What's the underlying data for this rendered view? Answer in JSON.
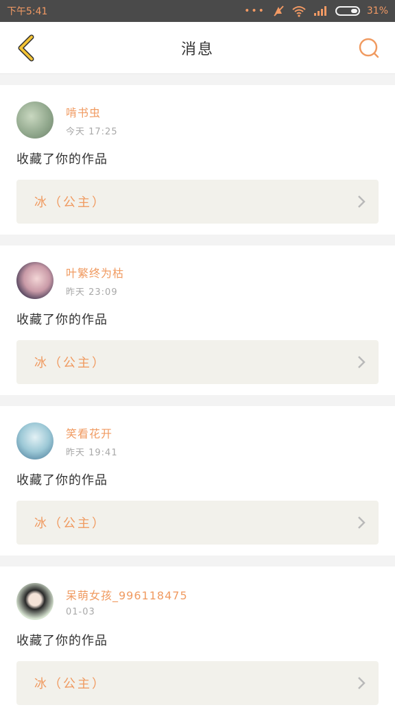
{
  "status_bar": {
    "time": "下午5:41",
    "battery": "31%"
  },
  "header": {
    "title": "消息"
  },
  "messages": [
    {
      "name": "啃书虫",
      "time": "今天 17:25",
      "action": "收藏了你的作品",
      "work": "冰（公主）"
    },
    {
      "name": "叶繁终为枯",
      "time": "昨天 23:09",
      "action": "收藏了你的作品",
      "work": "冰（公主）"
    },
    {
      "name": "笑看花开",
      "time": "昨天 19:41",
      "action": "收藏了你的作品",
      "work": "冰（公主）"
    },
    {
      "name": "呆萌女孩_996118475",
      "time": "01-03",
      "action": "收藏了你的作品",
      "work": "冰（公主）"
    }
  ],
  "colors": {
    "accent": "#f09a60",
    "back_arrow": "#f3c335",
    "status_bg": "#4a4a4a"
  },
  "icons": {
    "back": "chevron-left-icon",
    "search": "search-icon",
    "item": "chevron-right-icon"
  }
}
